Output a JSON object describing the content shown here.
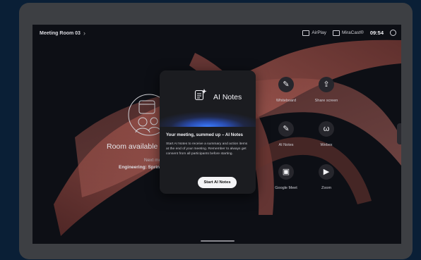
{
  "topbar": {
    "room_name": "Meeting Room 03",
    "room_chevron": "›",
    "airplay_label": "AirPlay",
    "miracast_label": "MiraCast®",
    "time": "09:54"
  },
  "room_status": {
    "available_text": "Room available n",
    "next_meeting_label": "Next meeti",
    "next_meeting_title": "Engineering: Sprin"
  },
  "apps": [
    {
      "label": "Whiteboard",
      "icon": "pencil-icon",
      "glyph": "✎"
    },
    {
      "label": "Share screen",
      "icon": "share-screen-icon",
      "glyph": "⇪"
    },
    {
      "label": "AI Notes",
      "icon": "ai-notes-icon",
      "glyph": "✎"
    },
    {
      "label": "Webex",
      "icon": "webex-icon",
      "glyph": "ω"
    },
    {
      "label": "Google Meet",
      "icon": "google-meet-icon",
      "glyph": "▣"
    },
    {
      "label": "Zoom",
      "icon": "zoom-icon",
      "glyph": "▶"
    }
  ],
  "modal": {
    "hero_title": "AI Notes",
    "heading": "Your meeting, summed up – AI Notes",
    "body": "Start AI Notes to receive a summary and action items at the end of your meeting. Remember to always get consent from all participants before starting.",
    "button_label": "Start AI Notes"
  },
  "colors": {
    "background": "#0a1f36",
    "device_frame": "#3d3f43",
    "ribbon": "#a0544e",
    "accent_glow": "#3b7cff"
  }
}
